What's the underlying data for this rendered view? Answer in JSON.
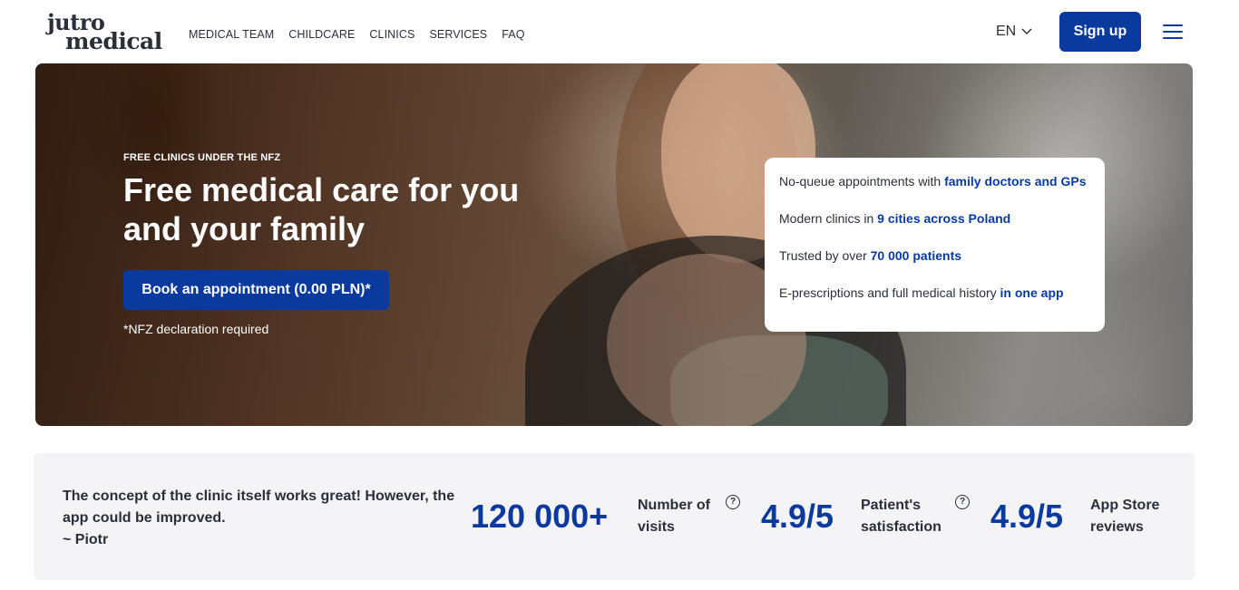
{
  "header": {
    "logo_line1": "jutro",
    "logo_line2": "medical",
    "nav": [
      "MEDICAL TEAM",
      "CHILDCARE",
      "CLINICS",
      "SERVICES",
      "FAQ"
    ],
    "language": "EN",
    "signup_label": "Sign up"
  },
  "hero": {
    "eyebrow": "FREE CLINICS UNDER THE NFZ",
    "headline": "Free medical care for you and your family",
    "cta_label": "Book an appointment (0.00 PLN)*",
    "note": "*NFZ declaration required",
    "features": [
      {
        "text": "No-queue appointments with ",
        "highlight": "family doctors and GPs"
      },
      {
        "text": "Modern clinics in ",
        "highlight": "9 cities across Poland"
      },
      {
        "text": "Trusted by over ",
        "highlight": "70 000 patients"
      },
      {
        "text": "E-prescriptions and full medical history ",
        "highlight": "in one app"
      }
    ]
  },
  "stats": {
    "quote_text": "The concept of the clinic itself works great! However, the app could be improved.",
    "quote_author": "~ Piotr",
    "items": [
      {
        "value": "120 000+",
        "label_line1": "Number of",
        "label_line2": "visits",
        "help": "?"
      },
      {
        "value": "4.9/5",
        "label_line1": "Patient's",
        "label_line2": "satisfaction",
        "help": "?"
      },
      {
        "value": "4.9/5",
        "label_line1": "App Store",
        "label_line2": "reviews"
      }
    ]
  },
  "colors": {
    "brand_blue": "#0a3a9e",
    "text_dark": "#2a2f3a",
    "stats_background": "#f4f4f6"
  },
  "icons": [
    "chevron-down-icon",
    "hamburger-menu-icon",
    "question-circle-icon"
  ]
}
